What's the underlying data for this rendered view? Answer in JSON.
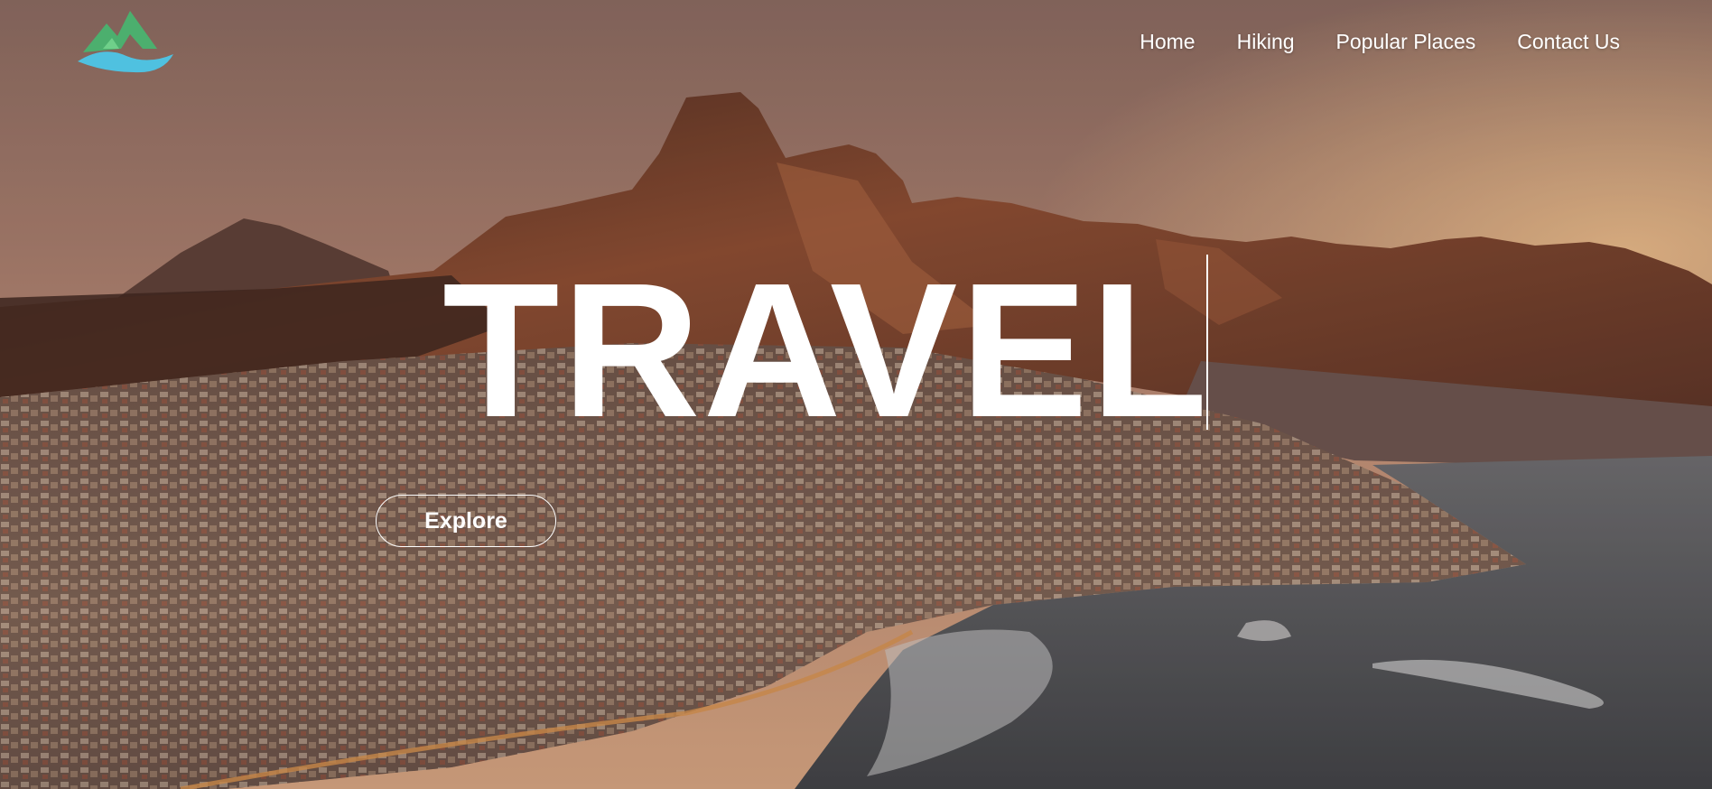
{
  "nav": {
    "logo_icon": "mountain-wave-logo",
    "items": [
      {
        "label": "Home"
      },
      {
        "label": "Hiking"
      },
      {
        "label": "Popular Places"
      },
      {
        "label": "Contact Us"
      }
    ]
  },
  "hero": {
    "headline": "TRAVEL",
    "cta_label": "Explore",
    "background": "aerial-coastal-city-mountain-sunset-photo"
  },
  "colors": {
    "text": "#ffffff",
    "logo_green": "#4caf6e",
    "logo_blue": "#4fc1e0",
    "sky_top": "#8a6a5e",
    "sky_glow": "#e8b48a",
    "mountain": "#6b3d2a",
    "sea": "#4d5157"
  }
}
